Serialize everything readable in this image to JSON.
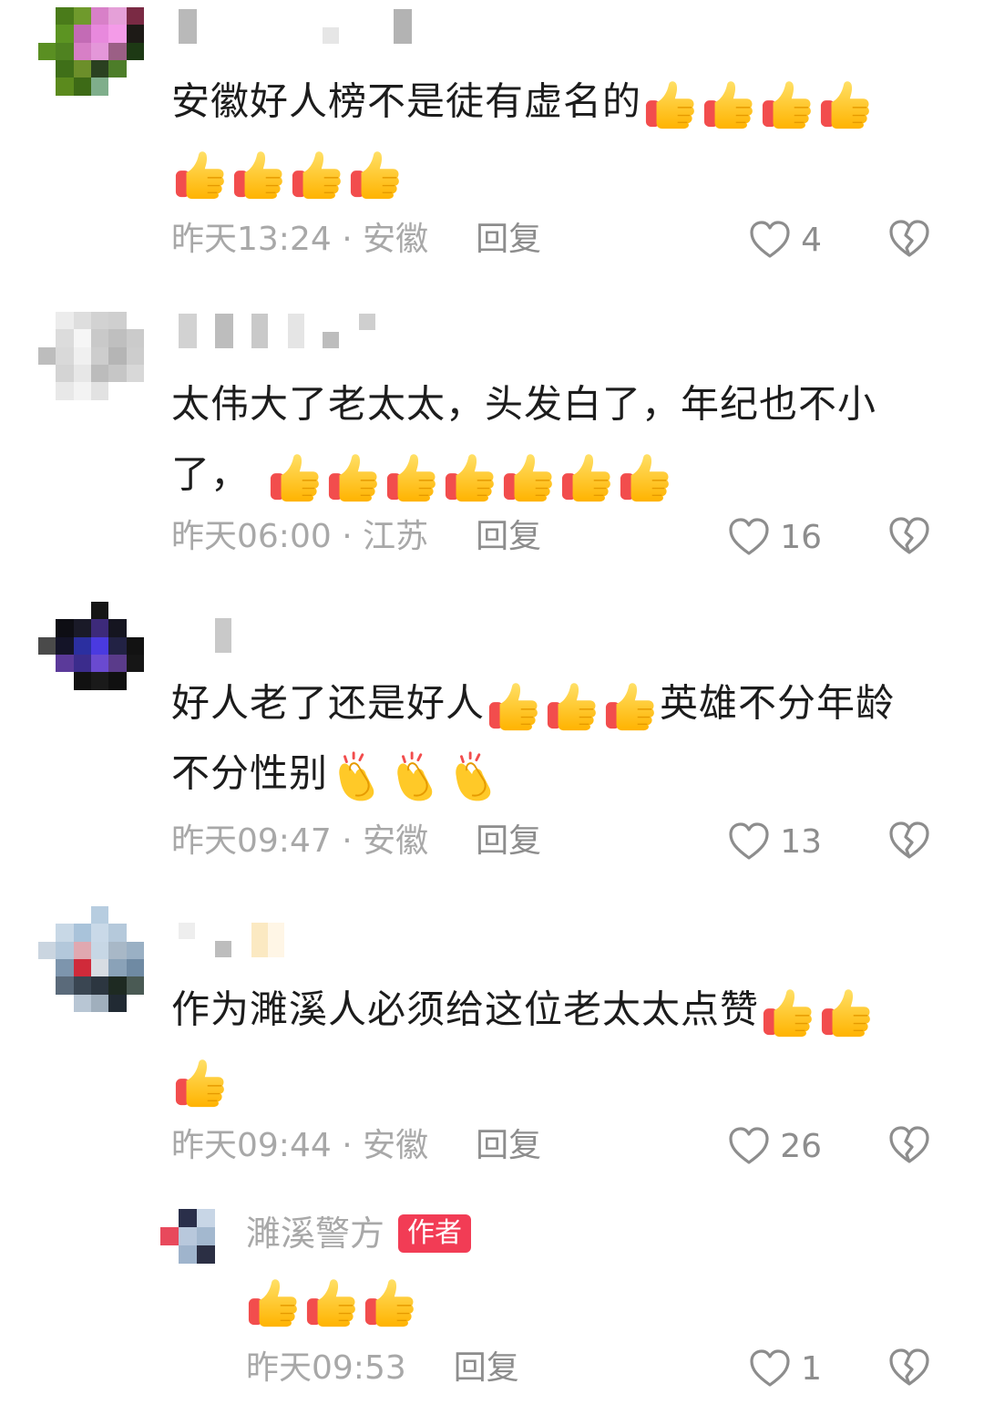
{
  "comments": [
    {
      "body": "安徽好人榜不是徒有虚名的",
      "emoji_after_body": 4,
      "emoji_second_line": 4,
      "time": "昨天13:24",
      "location": "安徽",
      "reply_label": "回复",
      "likes": "4"
    },
    {
      "body": "太伟大了老太太，头发白了，年纪也不小",
      "body2": "了，",
      "emoji_second_line": 7,
      "time": "昨天06:00",
      "location": "江苏",
      "reply_label": "回复",
      "likes": "16"
    },
    {
      "body": "好人老了还是好人",
      "body_mid": "英雄不分年龄",
      "body2": "不分性别",
      "emoji_after_body": 3,
      "clap_second_line": 3,
      "time": "昨天09:47",
      "location": "安徽",
      "reply_label": "回复",
      "likes": "13"
    },
    {
      "body": "作为濉溪人必须给这位老太太点赞",
      "emoji_after_body": 2,
      "emoji_second_line": 1,
      "time": "昨天09:44",
      "location": "安徽",
      "reply_label": "回复",
      "likes": "26"
    }
  ],
  "author_reply": {
    "name": "濉溪警方",
    "badge": "作者",
    "emoji_count": 3,
    "time": "昨天09:53",
    "reply_label": "回复",
    "likes": "1"
  },
  "separator": " · ",
  "icons": {
    "like": "heart-outline-icon",
    "dislike": "broken-heart-icon",
    "thumbs_up": "thumbs-up-emoji",
    "clap": "clapping-hands-emoji"
  },
  "colors": {
    "meta": "#a8a8a8",
    "author_badge": "#f23c55",
    "thumb_yellow": "#ffc928",
    "thumb_cuff": "#f24d4d"
  }
}
